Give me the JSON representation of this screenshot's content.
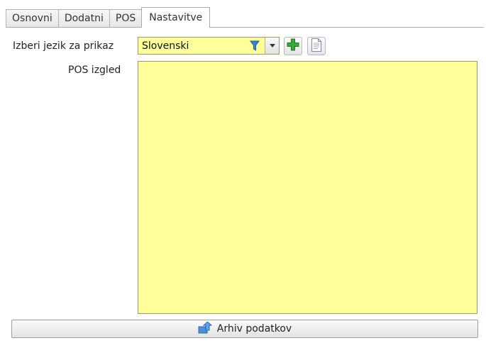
{
  "tabs": [
    {
      "label": "Osnovni"
    },
    {
      "label": "Dodatni"
    },
    {
      "label": "POS"
    },
    {
      "label": "Nastavitve"
    }
  ],
  "form": {
    "language_label": "Izberi jezik za prikaz",
    "language_value": "Slovenski",
    "pos_label": "POS izgled",
    "pos_value": ""
  },
  "icons": {
    "filter": "filter-icon",
    "dropdown": "chevron-down-icon",
    "add": "plus-icon",
    "document": "document-icon",
    "archive": "archive-upload-icon"
  },
  "colors": {
    "field_background": "#ffff99",
    "add_green": "#3aa83a",
    "filter_blue": "#3a86c8"
  },
  "footer": {
    "archive_label": "Arhiv podatkov"
  }
}
